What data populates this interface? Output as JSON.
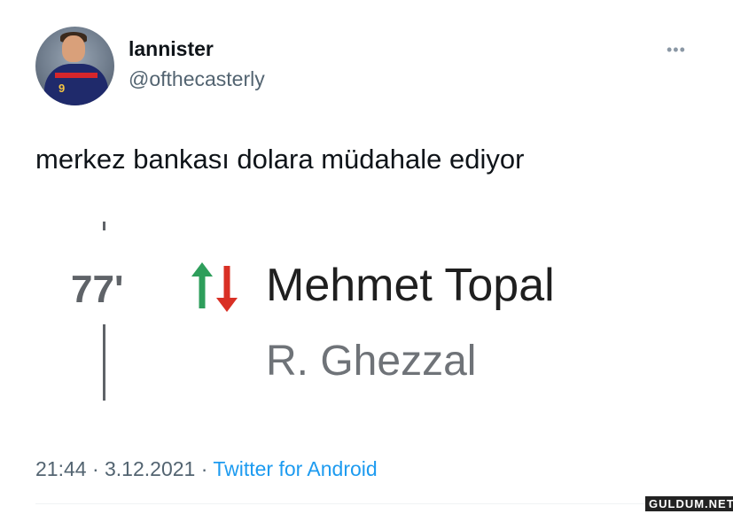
{
  "author": {
    "display_name": "lannister",
    "handle": "@ofthecasterly"
  },
  "tweet": {
    "text": "merkez bankası dolara müdahale ediyor",
    "timestamp": "21:44 · 3.12.2021 · ",
    "source": "Twitter for Android"
  },
  "media": {
    "minute": "77'",
    "player_in": "Mehmet Topal",
    "player_out": "R. Ghezzal",
    "colors": {
      "arrow_up": "#2e9e5b",
      "arrow_down": "#d93025"
    }
  },
  "watermark": "GULDUM.NET"
}
